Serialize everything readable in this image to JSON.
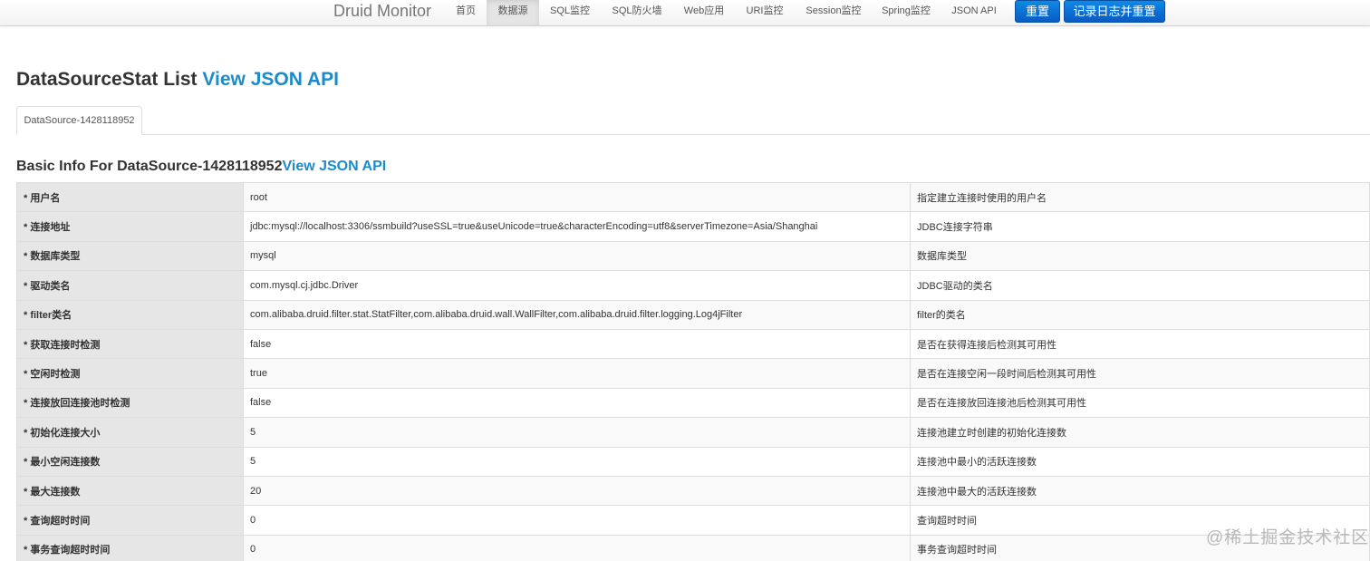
{
  "nav": {
    "brand": "Druid Monitor",
    "items": [
      {
        "label": "首页",
        "active": false
      },
      {
        "label": "数据源",
        "active": true
      },
      {
        "label": "SQL监控",
        "active": false
      },
      {
        "label": "SQL防火墙",
        "active": false
      },
      {
        "label": "Web应用",
        "active": false
      },
      {
        "label": "URI监控",
        "active": false
      },
      {
        "label": "Session监控",
        "active": false
      },
      {
        "label": "Spring监控",
        "active": false
      },
      {
        "label": "JSON API",
        "active": false
      }
    ],
    "reset_button": "重置",
    "log_reset_button": "记录日志并重置"
  },
  "page": {
    "title": "DataSourceStat List",
    "json_link": "View JSON API",
    "tab_label": "DataSource-1428118952",
    "section_title": "Basic Info For DataSource-1428118952",
    "section_json_link": "View JSON API"
  },
  "rows": [
    {
      "key": "* 用户名",
      "value": "root",
      "desc": "指定建立连接时使用的用户名"
    },
    {
      "key": "* 连接地址",
      "value": "jdbc:mysql://localhost:3306/ssmbuild?useSSL=true&useUnicode=true&characterEncoding=utf8&serverTimezone=Asia/Shanghai",
      "desc": "JDBC连接字符串"
    },
    {
      "key": "* 数据库类型",
      "value": "mysql",
      "desc": "数据库类型"
    },
    {
      "key": "* 驱动类名",
      "value": "com.mysql.cj.jdbc.Driver",
      "desc": "JDBC驱动的类名"
    },
    {
      "key": "* filter类名",
      "value": "com.alibaba.druid.filter.stat.StatFilter,com.alibaba.druid.wall.WallFilter,com.alibaba.druid.filter.logging.Log4jFilter",
      "desc": "filter的类名"
    },
    {
      "key": "* 获取连接时检测",
      "value": "false",
      "desc": "是否在获得连接后检测其可用性"
    },
    {
      "key": "* 空闲时检测",
      "value": "true",
      "desc": "是否在连接空闲一段时间后检测其可用性"
    },
    {
      "key": "* 连接放回连接池时检测",
      "value": "false",
      "desc": "是否在连接放回连接池后检测其可用性"
    },
    {
      "key": "* 初始化连接大小",
      "value": "5",
      "desc": "连接池建立时创建的初始化连接数"
    },
    {
      "key": "* 最小空闲连接数",
      "value": "5",
      "desc": "连接池中最小的活跃连接数"
    },
    {
      "key": "* 最大连接数",
      "value": "20",
      "desc": "连接池中最大的活跃连接数"
    },
    {
      "key": "* 查询超时时间",
      "value": "0",
      "desc": "查询超时时间"
    },
    {
      "key": "* 事务查询超时时间",
      "value": "0",
      "desc": "事务查询超时时间"
    }
  ],
  "watermark": "@稀土掘金技术社区",
  "colors": {
    "link": "#1a8cca",
    "button": "#0a6fd6",
    "key_cell": "#e6e6e6"
  }
}
